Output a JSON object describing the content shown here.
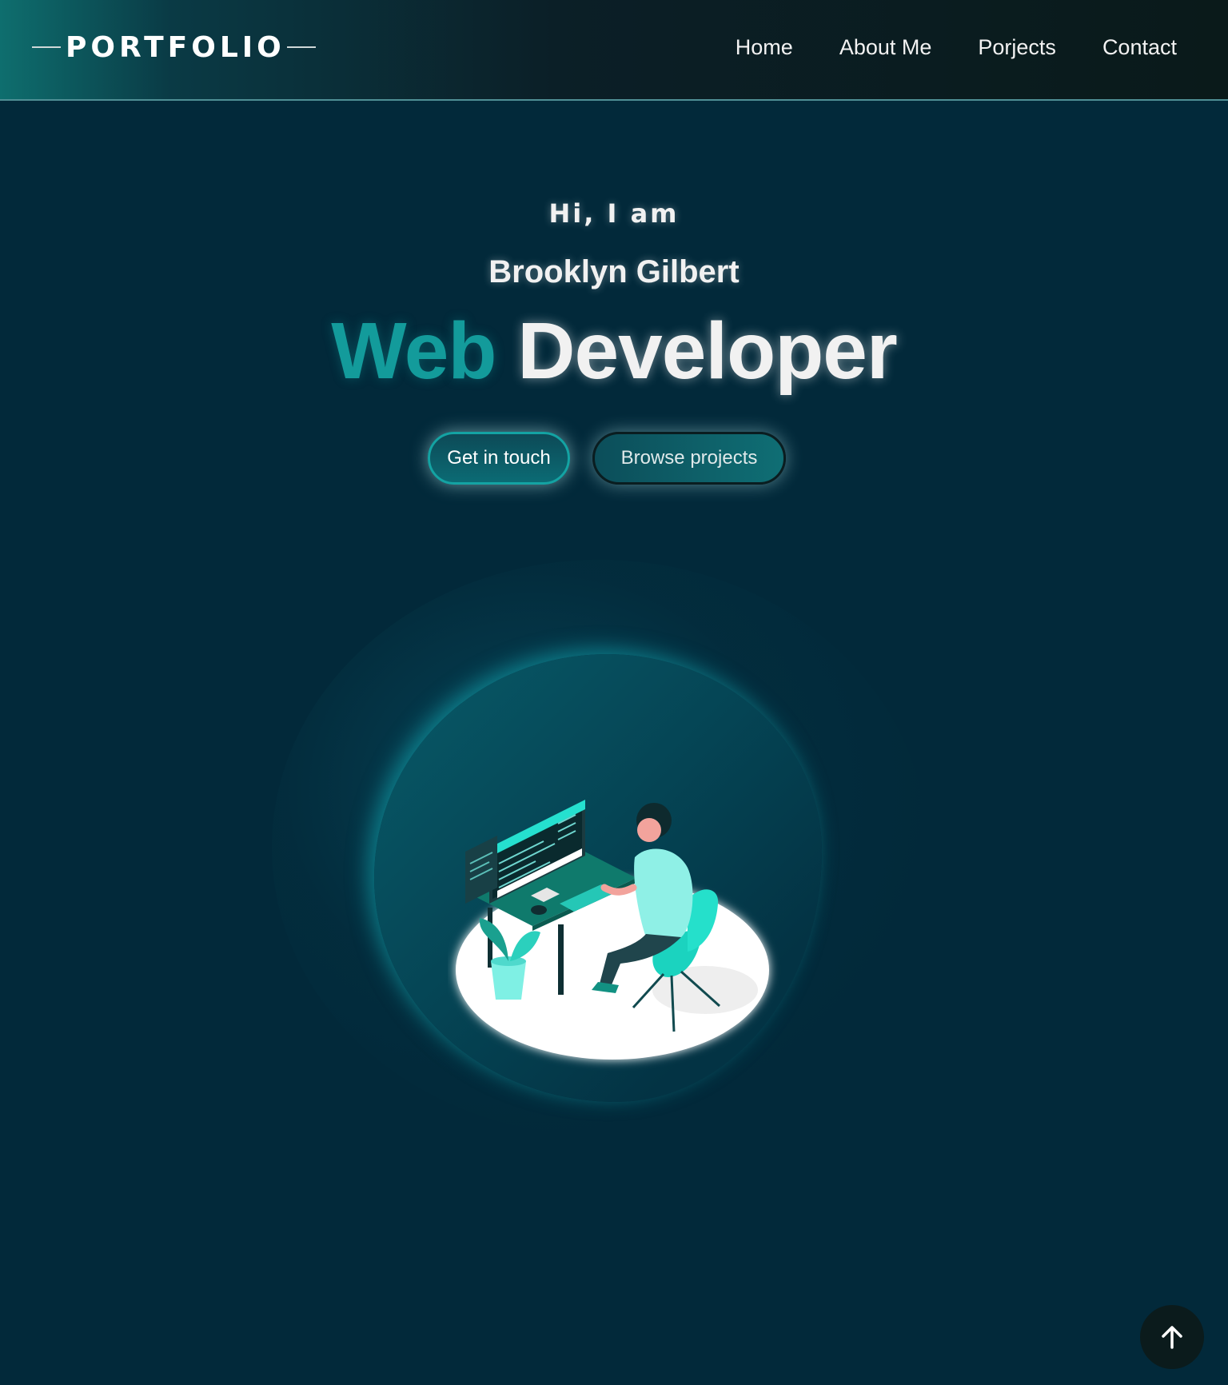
{
  "header": {
    "logo": "PORTFOLIO",
    "nav": [
      "Home",
      "About Me",
      "Porjects",
      "Contact"
    ]
  },
  "hero": {
    "greeting": "Hi, I am",
    "name": "Brooklyn Gilbert",
    "title_accent": "Web",
    "title_main": "Developer",
    "buttons": {
      "primary": "Get in touch",
      "secondary": "Browse projects"
    }
  },
  "colors": {
    "background": "#02293a",
    "accent": "#139b9b",
    "header_dark": "#0a1a1a"
  },
  "icons": {
    "scroll_top": "arrow-up-icon",
    "illustration": "developer-at-desk-illustration"
  }
}
